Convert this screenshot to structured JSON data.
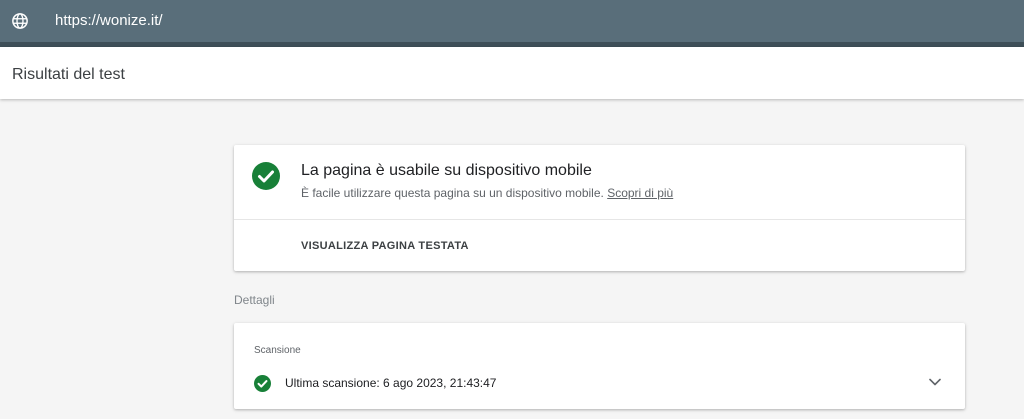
{
  "topbar": {
    "url": "https://wonize.it/",
    "icon": "globe-icon"
  },
  "header": {
    "title": "Risultati del test"
  },
  "result": {
    "icon": "check-circle-icon",
    "title": "La pagina è usabile su dispositivo mobile",
    "subtitle": "È facile utilizzare questa pagina su un dispositivo mobile.",
    "learn_more": "Scopri di più",
    "view_button": "VISUALIZZA PAGINA TESTATA"
  },
  "details": {
    "section_label": "Dettagli",
    "scan": {
      "label": "Scansione",
      "icon": "check-circle-icon",
      "text": "Ultima scansione: 6 ago 2023, 21:43:47",
      "expand_icon": "chevron-down-icon"
    }
  },
  "colors": {
    "topbar": "#596e7a",
    "topbar_strip": "#3e4f58",
    "success": "#188038",
    "background": "#f5f5f5"
  }
}
